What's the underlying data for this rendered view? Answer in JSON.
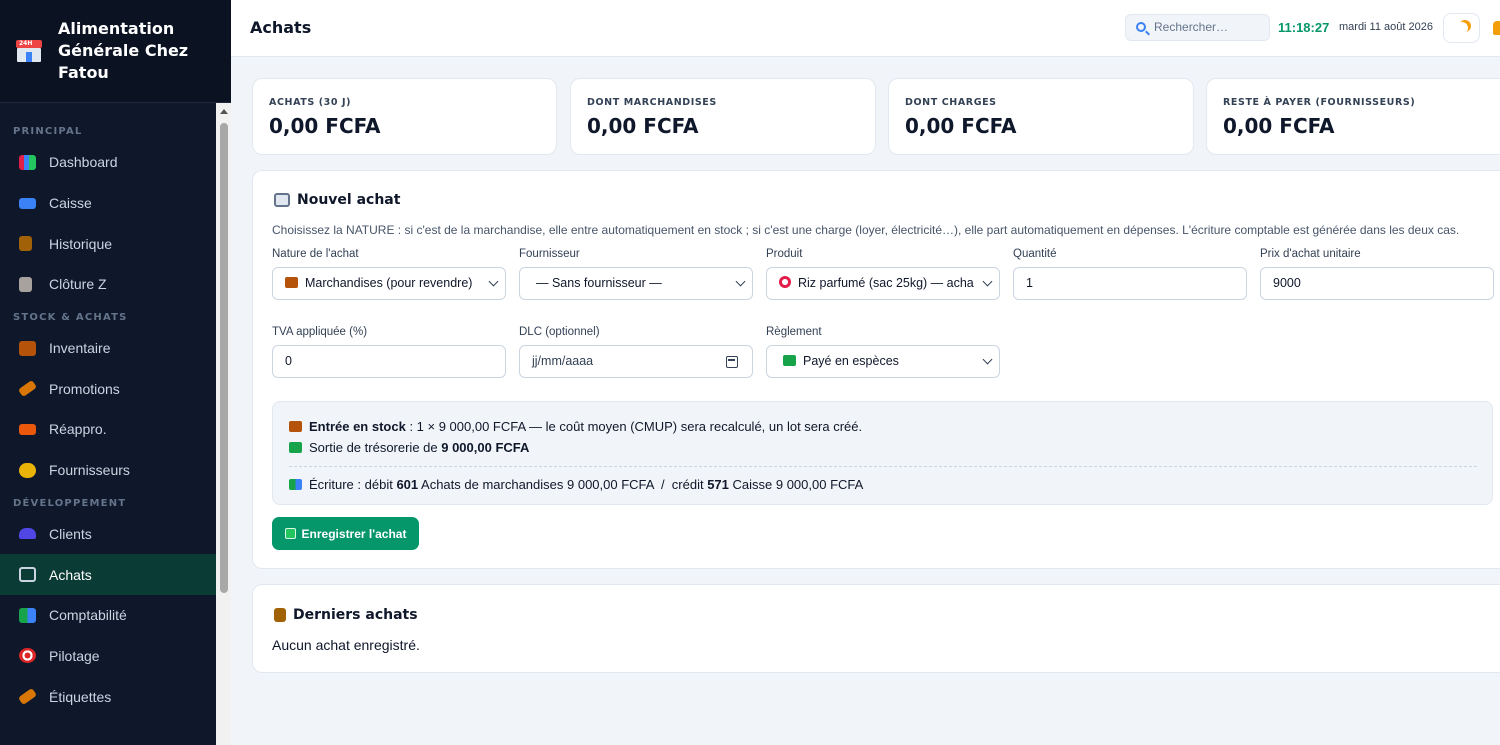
{
  "brand": {
    "name": "Alimentation Générale Chez Fatou"
  },
  "sidebar": {
    "sections": [
      {
        "title": "PRINCIPAL",
        "items": [
          {
            "label": "Dashboard",
            "icon": "chart-icon",
            "color": "#e11d48"
          },
          {
            "label": "Caisse",
            "icon": "credit-card-icon",
            "color": "#3b82f6"
          },
          {
            "label": "Historique",
            "icon": "clipboard-icon",
            "color": "#a16207"
          },
          {
            "label": "Clôture Z",
            "icon": "receipt-icon",
            "color": "#a8a29e"
          }
        ]
      },
      {
        "title": "STOCK & ACHATS",
        "items": [
          {
            "label": "Inventaire",
            "icon": "box-icon",
            "color": "#b45309"
          },
          {
            "label": "Promotions",
            "icon": "tag-icon",
            "color": "#d97706"
          },
          {
            "label": "Réappro.",
            "icon": "truck-icon",
            "color": "#ea580c"
          },
          {
            "label": "Fournisseurs",
            "icon": "handshake-icon",
            "color": "#eab308"
          }
        ]
      },
      {
        "title": "DÉVELOPPEMENT",
        "items": [
          {
            "label": "Clients",
            "icon": "users-icon",
            "color": "#6366f1"
          },
          {
            "label": "Achats",
            "icon": "cart-icon",
            "color": "#94a3b8",
            "active": true
          },
          {
            "label": "Comptabilité",
            "icon": "books-icon",
            "color": "#16a34a"
          },
          {
            "label": "Pilotage",
            "icon": "target-icon",
            "color": "#dc2626"
          },
          {
            "label": "Étiquettes",
            "icon": "label-icon",
            "color": "#d97706"
          }
        ]
      }
    ]
  },
  "header": {
    "title": "Achats",
    "search_placeholder": "Rechercher…",
    "time": "11:18:27",
    "date": "mardi 11 août 2026"
  },
  "stats": [
    {
      "label": "ACHATS (30 J)",
      "value": "0,00 FCFA"
    },
    {
      "label": "DONT MARCHANDISES",
      "value": "0,00 FCFA"
    },
    {
      "label": "DONT CHARGES",
      "value": "0,00 FCFA"
    },
    {
      "label": "RESTE À PAYER (FOURNISSEURS)",
      "value": "0,00 FCFA"
    }
  ],
  "form": {
    "title": "Nouvel achat",
    "hint": "Choisissez la NATURE : si c'est de la marchandise, elle entre automatiquement en stock ; si c'est une charge (loyer, électricité…), elle part automatiquement en dépenses. L'écriture comptable est générée dans les deux cas.",
    "nature_label": "Nature de l'achat",
    "nature_value": "Marchandises (pour revendre)",
    "supplier_label": "Fournisseur",
    "supplier_value": "— Sans fournisseur —",
    "product_label": "Produit",
    "product_value": "Riz parfumé (sac 25kg) — acha",
    "qty_label": "Quantité",
    "qty_value": "1",
    "price_label": "Prix d'achat unitaire",
    "price_value": "9000",
    "vat_label": "TVA appliquée (%)",
    "vat_value": "0",
    "dlc_label": "DLC (optionnel)",
    "dlc_placeholder": "jj/mm/aaaa",
    "payment_label": "Règlement",
    "payment_value": "Payé en espèces",
    "summary": {
      "stock_title": "Entrée en stock",
      "stock_text": " : 1 × 9 000,00 FCFA — le coût moyen (CMUP) sera recalculé, un lot sera créé.",
      "cash_text": "Sortie de trésorerie de ",
      "cash_amount": "9 000,00 FCFA",
      "entry_prefix": "Écriture : débit ",
      "debit_account": "601",
      "debit_text": " Achats de marchandises 9 000,00 FCFA  /  crédit ",
      "credit_account": "571",
      "credit_text": " Caisse 9 000,00 FCFA"
    },
    "save_label": "Enregistrer l'achat"
  },
  "recent": {
    "title": "Derniers achats",
    "empty_text": "Aucun achat enregistré."
  }
}
